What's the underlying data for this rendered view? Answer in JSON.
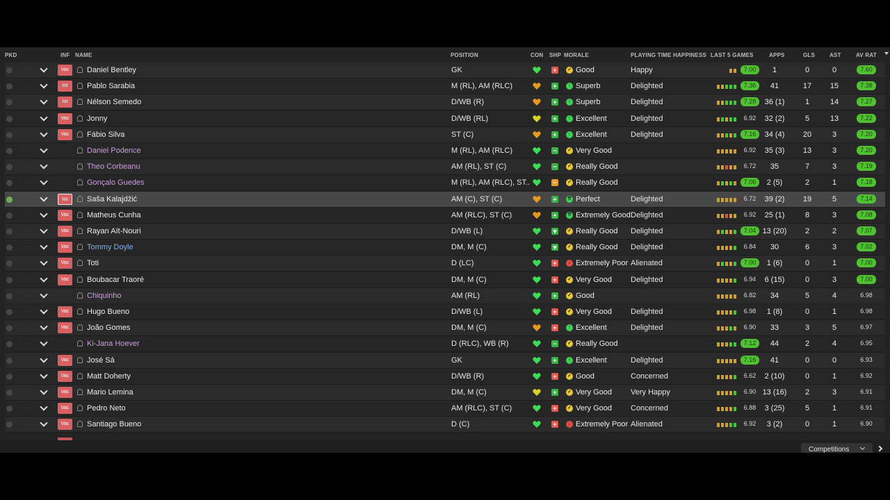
{
  "colors": {
    "green_rating": "#4fc132",
    "inf_badge": "#d86060",
    "loan_name": "#c9a0d8",
    "highlight_name": "#7fb0e4",
    "selected_row": "#474747"
  },
  "headers": {
    "pkd": "PKD",
    "inf": "INF",
    "name": "NAME",
    "position": "POSITION",
    "con": "CON",
    "shp": "SHP",
    "morale": "MORALE",
    "playing_time": "PLAYING TIME HAPPINESS",
    "last5": "LAST 5 GAMES",
    "apps": "APPS",
    "gls": "GLS",
    "ast": "AST",
    "avrat": "AV RAT"
  },
  "footer": {
    "competitions": "Competitions"
  },
  "players": [
    {
      "picked": false,
      "dash": "-",
      "inf": "Vac",
      "name": "Daniel Bentley",
      "name_style": "normal",
      "position": "GK",
      "con": "green",
      "shp": "red",
      "morale_icon": "ok",
      "morale": "Good",
      "pth": "Happy",
      "last5": [
        "",
        "",
        "",
        "o",
        "o"
      ],
      "last_rating": "7.00",
      "last_rating_green": true,
      "apps": "1",
      "gls": "0",
      "ast": "0",
      "avrat": "7.60",
      "avrat_green": true
    },
    {
      "picked": false,
      "dash": "-",
      "inf": "Int",
      "name": "Pablo Sarabia",
      "name_style": "normal",
      "position": "M (RL), AM (RLC)",
      "con": "orange",
      "shp": "green",
      "morale_icon": "up",
      "morale": "Superb",
      "pth": "Delighted",
      "last5": [
        "o",
        "o",
        "g",
        "g",
        "g"
      ],
      "last_rating": "7.36",
      "last_rating_green": true,
      "apps": "41",
      "gls": "17",
      "ast": "15",
      "avrat": "7.38",
      "avrat_green": true
    },
    {
      "picked": false,
      "dash": "-",
      "inf": "Int",
      "name": "Nélson Semedo",
      "name_style": "normal",
      "position": "D/WB (R)",
      "con": "orange",
      "shp": "green",
      "morale_icon": "up",
      "morale": "Superb",
      "pth": "Delighted",
      "last5": [
        "o",
        "o",
        "g",
        "g",
        "g"
      ],
      "last_rating": "7.28",
      "last_rating_green": true,
      "apps": "36 (1)",
      "gls": "1",
      "ast": "14",
      "avrat": "7.27",
      "avrat_green": true
    },
    {
      "picked": false,
      "dash": "-",
      "inf": "Vac",
      "name": "Jonny",
      "name_style": "normal",
      "position": "D/WB (RL)",
      "con": "yellow",
      "shp": "green",
      "morale_icon": "up",
      "morale": "Excellent",
      "pth": "Delighted",
      "last5": [
        "o",
        "g",
        "o",
        "g",
        "g"
      ],
      "last_rating": "6.92",
      "last_rating_green": false,
      "apps": "32 (2)",
      "gls": "5",
      "ast": "13",
      "avrat": "7.22",
      "avrat_green": true
    },
    {
      "picked": false,
      "dash": "-",
      "inf": "Vac",
      "name": "Fábio Silva",
      "name_style": "normal",
      "position": "ST (C)",
      "con": "orange",
      "shp": "green",
      "morale_icon": "up",
      "morale": "Excellent",
      "pth": "Delighted",
      "last5": [
        "o",
        "o",
        "g",
        "o",
        "g"
      ],
      "last_rating": "7.16",
      "last_rating_green": true,
      "apps": "34 (4)",
      "gls": "20",
      "ast": "3",
      "avrat": "7.20",
      "avrat_green": true
    },
    {
      "picked": false,
      "dash": "-",
      "inf": "",
      "name": "Daniel Podence",
      "name_style": "loan",
      "position": "M (RL), AM (RLC)",
      "con": "green",
      "shp": "green-bar",
      "morale_icon": "ok",
      "morale": "Very Good",
      "pth": "",
      "last5": [
        "o",
        "o",
        "o",
        "o",
        "o"
      ],
      "last_rating": "6.92",
      "last_rating_green": false,
      "apps": "35 (3)",
      "gls": "13",
      "ast": "3",
      "avrat": "7.20",
      "avrat_green": true
    },
    {
      "picked": false,
      "dash": "-",
      "inf": "",
      "name": "Theo Corbeanu",
      "name_style": "loan",
      "position": "AM (RL), ST (C)",
      "con": "green",
      "shp": "green-bar",
      "morale_icon": "ok",
      "morale": "Really Good",
      "pth": "",
      "last5": [
        "o",
        "o",
        "r",
        "o",
        "o"
      ],
      "last_rating": "6.72",
      "last_rating_green": false,
      "apps": "35",
      "gls": "7",
      "ast": "3",
      "avrat": "7.19",
      "avrat_green": true
    },
    {
      "picked": false,
      "dash": "-",
      "inf": "",
      "name": "Gonçalo Guedes",
      "name_style": "loan",
      "position": "M (RL), AM (RLC), ST...",
      "con": "green",
      "shp": "orange-bar",
      "morale_icon": "ok",
      "morale": "Really Good",
      "pth": "",
      "last5": [
        "o",
        "g",
        "o",
        "g",
        "o"
      ],
      "last_rating": "7.06",
      "last_rating_green": true,
      "apps": "2 (5)",
      "gls": "2",
      "ast": "1",
      "avrat": "7.18",
      "avrat_green": true
    },
    {
      "picked": true,
      "dash": "-",
      "inf": "Int",
      "name": "Saša Kalajdžić",
      "name_style": "normal",
      "position": "AM (C), ST (C)",
      "con": "orange",
      "shp": "green",
      "morale_icon": "upup",
      "morale": "Perfect",
      "pth": "Delighted",
      "last5": [
        "o",
        "o",
        "o",
        "o",
        "o"
      ],
      "last_rating": "6.72",
      "last_rating_green": false,
      "apps": "39 (2)",
      "gls": "19",
      "ast": "5",
      "avrat": "7.14",
      "avrat_green": true
    },
    {
      "picked": false,
      "dash": "-",
      "inf": "Vac",
      "name": "Matheus Cunha",
      "name_style": "normal",
      "position": "AM (RLC), ST (C)",
      "con": "orange",
      "shp": "green",
      "morale_icon": "upup",
      "morale": "Extremely Good",
      "pth": "Delighted",
      "last5": [
        "o",
        "o",
        "r",
        "o",
        "o"
      ],
      "last_rating": "6.92",
      "last_rating_green": false,
      "apps": "25 (1)",
      "gls": "8",
      "ast": "3",
      "avrat": "7.08",
      "avrat_green": true
    },
    {
      "picked": false,
      "dash": "-",
      "inf": "Vac",
      "name": "Rayan Aït-Nouri",
      "name_style": "normal",
      "position": "D/WB (L)",
      "con": "green",
      "shp": "green-down",
      "morale_icon": "ok",
      "morale": "Really Good",
      "pth": "Delighted",
      "last5": [
        "o",
        "g",
        "o",
        "o",
        "g"
      ],
      "last_rating": "7.04",
      "last_rating_green": true,
      "apps": "13 (20)",
      "gls": "2",
      "ast": "2",
      "avrat": "7.07",
      "avrat_green": true
    },
    {
      "picked": false,
      "dash": "-",
      "inf": "Vac",
      "name": "Tommy Doyle",
      "name_style": "blue",
      "position": "DM, M (C)",
      "con": "green",
      "shp": "green-down",
      "morale_icon": "ok",
      "morale": "Really Good",
      "pth": "Delighted",
      "last5": [
        "o",
        "o",
        "o",
        "o",
        "g"
      ],
      "last_rating": "6.84",
      "last_rating_green": false,
      "apps": "30",
      "gls": "6",
      "ast": "3",
      "avrat": "7.02",
      "avrat_green": true
    },
    {
      "picked": false,
      "dash": "-",
      "inf": "Vac",
      "name": "Toti",
      "name_style": "normal",
      "position": "D (LC)",
      "con": "green",
      "shp": "red",
      "morale_icon": "down",
      "morale": "Extremely Poor",
      "pth": "Alienated",
      "last5": [
        "o",
        "g",
        "o",
        "o",
        "g"
      ],
      "last_rating": "7.00",
      "last_rating_green": true,
      "apps": "1 (6)",
      "gls": "0",
      "ast": "1",
      "avrat": "7.00",
      "avrat_green": true
    },
    {
      "picked": false,
      "dash": "-",
      "inf": "Vac",
      "name": "Boubacar Traoré",
      "name_style": "normal",
      "position": "DM, M (C)",
      "con": "green",
      "shp": "red",
      "morale_icon": "ok",
      "morale": "Very Good",
      "pth": "Delighted",
      "last5": [
        "o",
        "o",
        "o",
        "o",
        "g"
      ],
      "last_rating": "6.94",
      "last_rating_green": false,
      "apps": "6 (15)",
      "gls": "0",
      "ast": "3",
      "avrat": "7.00",
      "avrat_green": true
    },
    {
      "picked": false,
      "dash": "-",
      "inf": "",
      "name": "Chiquinho",
      "name_style": "loan",
      "position": "AM (RL)",
      "con": "green",
      "shp": "green",
      "morale_icon": "ok",
      "morale": "Good",
      "pth": "",
      "last5": [
        "o",
        "o",
        "o",
        "o",
        "o"
      ],
      "last_rating": "6.82",
      "last_rating_green": false,
      "apps": "34",
      "gls": "5",
      "ast": "4",
      "avrat": "6.98",
      "avrat_green": false
    },
    {
      "picked": false,
      "dash": "-",
      "inf": "Vac",
      "name": "Hugo Bueno",
      "name_style": "normal",
      "position": "D/WB (L)",
      "con": "green",
      "shp": "red",
      "morale_icon": "ok",
      "morale": "Very Good",
      "pth": "Delighted",
      "last5": [
        "o",
        "o",
        "o",
        "o",
        "g"
      ],
      "last_rating": "6.98",
      "last_rating_green": false,
      "apps": "1 (8)",
      "gls": "0",
      "ast": "1",
      "avrat": "6.98",
      "avrat_green": false
    },
    {
      "picked": false,
      "dash": "-",
      "inf": "Vac",
      "name": "João Gomes",
      "name_style": "normal",
      "position": "DM, M (C)",
      "con": "orange",
      "shp": "red",
      "morale_icon": "up",
      "morale": "Excellent",
      "pth": "Delighted",
      "last5": [
        "o",
        "o",
        "o",
        "g",
        "o"
      ],
      "last_rating": "6.90",
      "last_rating_green": false,
      "apps": "33",
      "gls": "3",
      "ast": "5",
      "avrat": "6.97",
      "avrat_green": false
    },
    {
      "picked": false,
      "dash": "-",
      "inf": "",
      "name": "Ki-Jana Hoever",
      "name_style": "loan",
      "position": "D (RLC), WB (R)",
      "con": "green",
      "shp": "green-bar",
      "morale_icon": "ok",
      "morale": "Really Good",
      "pth": "",
      "last5": [
        "o",
        "o",
        "o",
        "g",
        "g"
      ],
      "last_rating": "7.12",
      "last_rating_green": true,
      "apps": "44",
      "gls": "2",
      "ast": "4",
      "avrat": "6.95",
      "avrat_green": false
    },
    {
      "picked": false,
      "dash": "-",
      "inf": "Vac",
      "name": "José Sá",
      "name_style": "normal",
      "position": "GK",
      "con": "green",
      "shp": "green",
      "morale_icon": "up",
      "morale": "Excellent",
      "pth": "Delighted",
      "last5": [
        "o",
        "o",
        "o",
        "o",
        "o"
      ],
      "last_rating": "7.16",
      "last_rating_green": true,
      "apps": "41",
      "gls": "0",
      "ast": "0",
      "avrat": "6.93",
      "avrat_green": false
    },
    {
      "picked": false,
      "dash": "-",
      "inf": "Vac",
      "name": "Matt Doherty",
      "name_style": "normal",
      "position": "D/WB (R)",
      "con": "green",
      "shp": "red",
      "morale_icon": "ok",
      "morale": "Good",
      "pth": "Concerned",
      "last5": [
        "o",
        "o",
        "o",
        "o",
        "g"
      ],
      "last_rating": "6.62",
      "last_rating_green": false,
      "apps": "2 (10)",
      "gls": "0",
      "ast": "1",
      "avrat": "6.92",
      "avrat_green": false
    },
    {
      "picked": false,
      "dash": "-",
      "inf": "Vac",
      "name": "Mario Lemina",
      "name_style": "normal",
      "position": "DM, M (C)",
      "con": "yellow",
      "shp": "green",
      "morale_icon": "ok",
      "morale": "Very Good",
      "pth": "Very Happy",
      "last5": [
        "o",
        "o",
        "o",
        "o",
        "g"
      ],
      "last_rating": "6.90",
      "last_rating_green": false,
      "apps": "13 (16)",
      "gls": "2",
      "ast": "3",
      "avrat": "6.91",
      "avrat_green": false
    },
    {
      "picked": false,
      "dash": "-",
      "inf": "Vac",
      "name": "Pedro Neto",
      "name_style": "normal",
      "position": "AM (RLC), ST (C)",
      "con": "green",
      "shp": "red",
      "morale_icon": "ok",
      "morale": "Very Good",
      "pth": "Concerned",
      "last5": [
        "o",
        "o",
        "o",
        "o",
        "g"
      ],
      "last_rating": "6.88",
      "last_rating_green": false,
      "apps": "3 (25)",
      "gls": "5",
      "ast": "1",
      "avrat": "6.91",
      "avrat_green": false
    },
    {
      "picked": false,
      "dash": "-",
      "inf": "Vac",
      "name": "Santiago Bueno",
      "name_style": "normal",
      "position": "D (C)",
      "con": "green",
      "shp": "red",
      "morale_icon": "down",
      "morale": "Extremely Poor",
      "pth": "Alienated",
      "last5": [
        "o",
        "o",
        "o",
        "g",
        "g"
      ],
      "last_rating": "6.92",
      "last_rating_green": false,
      "apps": "3 (2)",
      "gls": "0",
      "ast": "1",
      "avrat": "6.90",
      "avrat_green": false
    }
  ]
}
